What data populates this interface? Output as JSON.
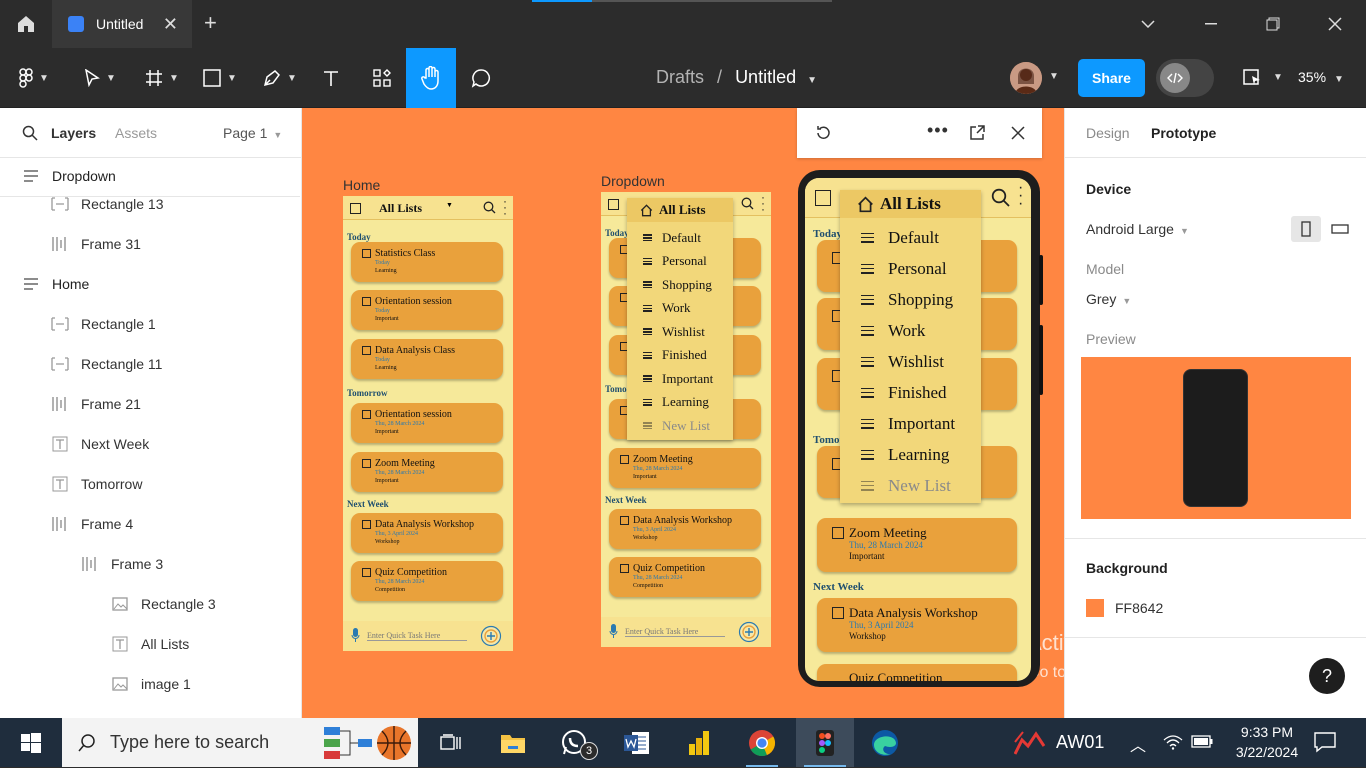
{
  "titlebar": {
    "tab_title": "Untitled",
    "new_tab": "+"
  },
  "toolbar": {
    "breadcrumb_parent": "Drafts",
    "breadcrumb_sep": "/",
    "breadcrumb_current": "Untitled",
    "share_label": "Share",
    "zoom_label": "35%"
  },
  "left_panel": {
    "tabs": [
      "Layers",
      "Assets"
    ],
    "page_selector": "Page 1",
    "layers": [
      {
        "name": "Dropdown",
        "type": "frame-stack",
        "indent": 0
      },
      {
        "name": "Rectangle 13",
        "type": "rect",
        "indent": 1
      },
      {
        "name": "Frame 31",
        "type": "frame-cols",
        "indent": 1
      },
      {
        "name": "Home",
        "type": "frame-stack",
        "indent": 0
      },
      {
        "name": "Rectangle 1",
        "type": "rect",
        "indent": 1
      },
      {
        "name": "Rectangle 11",
        "type": "rect",
        "indent": 1
      },
      {
        "name": "Frame 21",
        "type": "frame-cols",
        "indent": 1
      },
      {
        "name": "Next Week",
        "type": "text",
        "indent": 1
      },
      {
        "name": "Tomorrow",
        "type": "text",
        "indent": 1
      },
      {
        "name": "Frame 4",
        "type": "frame-cols",
        "indent": 1
      },
      {
        "name": "Frame 3",
        "type": "frame-cols",
        "indent": 2
      },
      {
        "name": "Rectangle 3",
        "type": "image",
        "indent": 3
      },
      {
        "name": "All Lists",
        "type": "text",
        "indent": 3
      },
      {
        "name": "image 1",
        "type": "image",
        "indent": 3
      }
    ]
  },
  "canvas": {
    "background": "#FF8642",
    "home_label": "Home",
    "dropdown_label": "Dropdown",
    "app": {
      "header_title": "All Lists",
      "sections": {
        "today": "Today",
        "tomorrow": "Tomorrow",
        "next_week": "Next Week"
      },
      "quick_task_placeholder": "Enter Quick Task Here",
      "tasks": [
        {
          "title": "Statistics Class",
          "date": "Today",
          "category": "Learning"
        },
        {
          "title": "Orientation session",
          "date": "Today",
          "category": "Important"
        },
        {
          "title": "Data Analysis Class",
          "date": "Today",
          "category": "Learning"
        },
        {
          "title": "Orientation session",
          "date": "Thu, 28 March 2024",
          "category": "Important"
        },
        {
          "title": "Zoom Meeting",
          "date": "Thu, 28 March 2024",
          "category": "Important"
        },
        {
          "title": "Data Analysis Workshop",
          "date": "Thu, 3 April 2024",
          "category": "Workshop"
        },
        {
          "title": "Quiz Competition",
          "date": "Thu, 28 March 2024",
          "category": "Competition"
        }
      ],
      "dropdown_items": [
        "Default",
        "Personal",
        "Shopping",
        "Work",
        "Wishlist",
        "Finished",
        "Important",
        "Learning"
      ],
      "new_list_label": "New List",
      "phone_partial_text": "Quiz Competition"
    },
    "watermark": {
      "line1": "Activate Windows",
      "line2": "Go to Settings to activate Windows."
    }
  },
  "right_panel": {
    "tabs": [
      "Design",
      "Prototype"
    ],
    "device_heading": "Device",
    "device_value": "Android Large",
    "model_label": "Model",
    "model_value": "Grey",
    "preview_label": "Preview",
    "background_heading": "Background",
    "background_hex": "FF8642",
    "help_label": "?"
  },
  "taskbar": {
    "search_placeholder": "Type here to search",
    "whatsapp_badge": "3",
    "tray_app": "AW01",
    "time": "9:33 PM",
    "date": "3/22/2024"
  },
  "colors": {
    "accent": "#0D99FF",
    "canvas": "#FF8642",
    "card": "#E9A13C",
    "screen": "#F6E99A"
  }
}
